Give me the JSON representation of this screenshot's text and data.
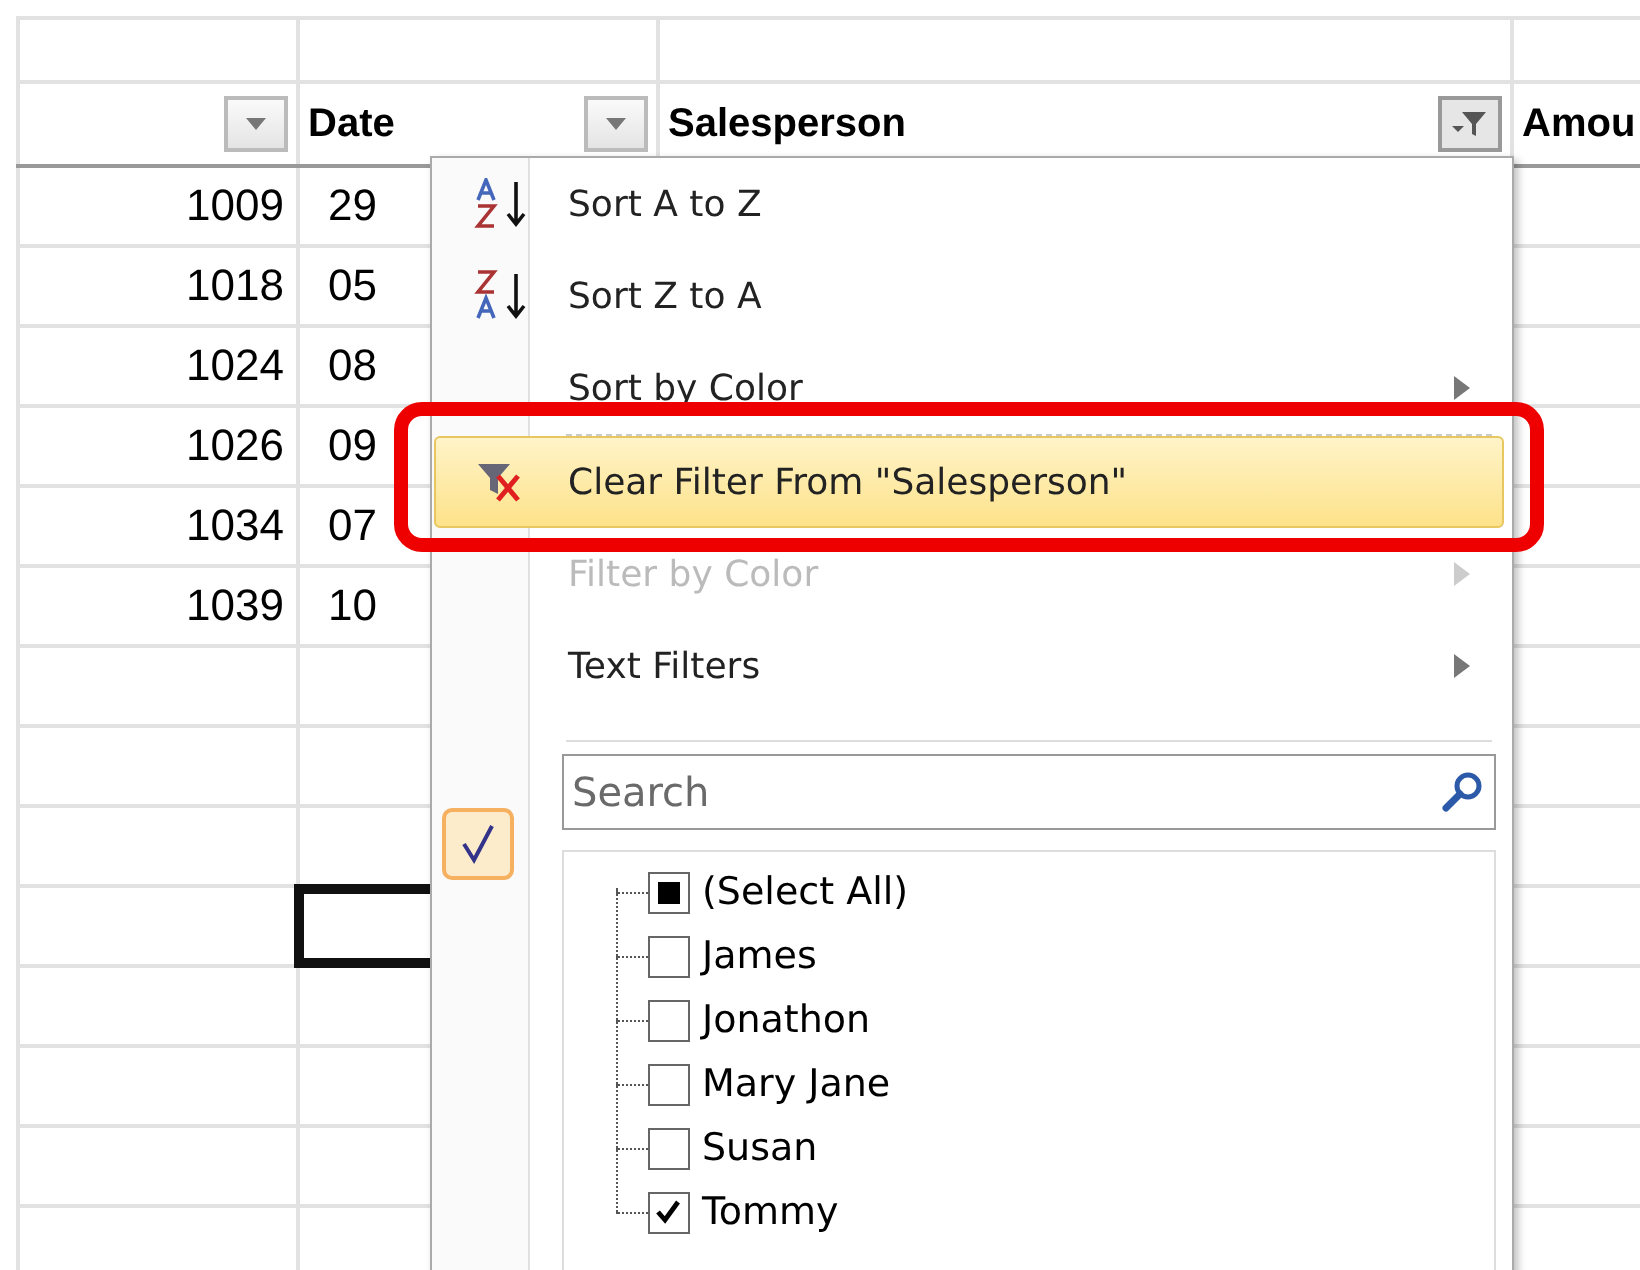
{
  "sheet": {
    "columns": [
      {
        "kind": "dropdown"
      },
      {
        "label": "Date",
        "kind": "dropdown"
      },
      {
        "label": "Salesperson",
        "kind": "filtered"
      },
      {
        "label": "Amou",
        "kind": "plain"
      }
    ],
    "rows": [
      {
        "cells": [
          "1009",
          "29"
        ],
        "selected": false
      },
      {
        "cells": [
          "1018",
          "05"
        ],
        "selected": false
      },
      {
        "cells": [
          "1024",
          "08"
        ],
        "selected": false
      },
      {
        "cells": [
          "1026",
          "09"
        ],
        "selected": false
      },
      {
        "cells": [
          "1034",
          "07"
        ],
        "selected": false
      },
      {
        "cells": [
          "1039",
          "10"
        ],
        "selected": false
      },
      {
        "selected": false
      },
      {
        "selected": false
      },
      {
        "selected": false
      },
      {
        "selected": true
      },
      {
        "selected": false
      },
      {
        "selected": false
      },
      {
        "selected": false
      },
      {
        "selected": false
      }
    ]
  },
  "filter_menu": {
    "items": [
      {
        "kind": "sort-az",
        "label": "Sort A to Z",
        "disabled": false,
        "submenu": false,
        "selected": false
      },
      {
        "kind": "sort-za",
        "label": "Sort Z to A",
        "disabled": false,
        "submenu": false,
        "selected": false
      },
      {
        "kind": "plain",
        "label": "Sort by Color",
        "disabled": false,
        "submenu": true,
        "selected": false
      },
      {
        "kind": "separator"
      },
      {
        "kind": "clear-filter",
        "label": "Clear Filter From \"Salesperson\"",
        "disabled": false,
        "submenu": false,
        "selected": true
      },
      {
        "kind": "plain",
        "label": "Filter by Color",
        "disabled": true,
        "submenu": true,
        "selected": false
      },
      {
        "kind": "plain",
        "label": "Text Filters",
        "disabled": false,
        "submenu": true,
        "selected": false
      }
    ],
    "search": {
      "placeholder": "Search"
    },
    "values": [
      {
        "label": "(Select All)",
        "checked": false,
        "partial": true
      },
      {
        "label": "James",
        "checked": false,
        "partial": false
      },
      {
        "label": "Jonathon",
        "checked": false,
        "partial": false
      },
      {
        "label": "Mary Jane",
        "checked": false,
        "partial": false
      },
      {
        "label": "Susan",
        "checked": false,
        "partial": false
      },
      {
        "label": "Tommy",
        "checked": true,
        "partial": false
      }
    ]
  }
}
